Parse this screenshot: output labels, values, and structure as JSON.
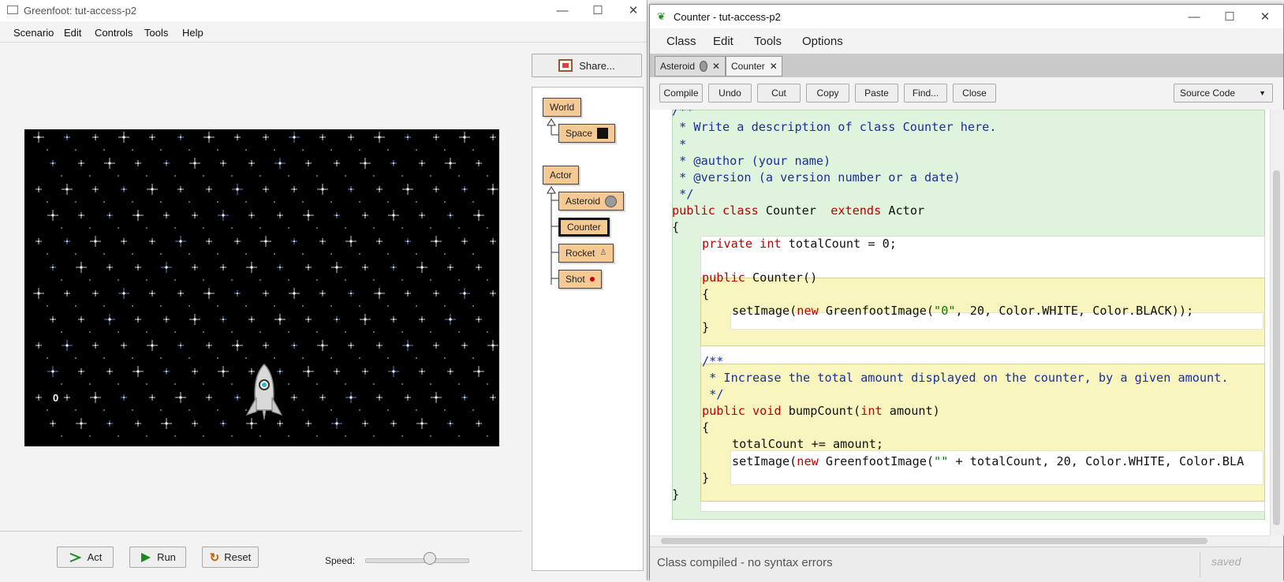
{
  "main_window": {
    "title": "Greenfoot: tut-access-p2",
    "controls": {
      "minimize": "—",
      "maximize": "☐",
      "close": "✕"
    },
    "menu": [
      "Scenario",
      "Edit",
      "Controls",
      "Tools",
      "Help"
    ],
    "counter_value": "0",
    "buttons": {
      "act": "Act",
      "run": "Run",
      "reset": "Reset",
      "share": "Share..."
    },
    "speed_label": "Speed:",
    "speed_level": 0.62,
    "classes": {
      "world": "World",
      "space": "Space",
      "actor": "Actor",
      "asteroid": "Asteroid",
      "counter": "Counter",
      "rocket": "Rocket",
      "shot": "Shot"
    }
  },
  "editor_window": {
    "title": "Counter - tut-access-p2",
    "controls": {
      "minimize": "—",
      "maximize": "☐",
      "close": "✕"
    },
    "menu": [
      "Class",
      "Edit",
      "Tools",
      "Options"
    ],
    "tabs": [
      {
        "label": "Asteroid",
        "close": "✕"
      },
      {
        "label": "Counter",
        "close": "✕"
      }
    ],
    "toolbar": [
      "Compile",
      "Undo",
      "Cut",
      "Copy",
      "Paste",
      "Find...",
      "Close"
    ],
    "view_select": "Source Code",
    "code": {
      "l0": "/**",
      "l1": " * Write a description of class Counter here.",
      "l2": " *",
      "l3": " * @author (your name)",
      "l4": " * @version (a version number or a date)",
      "l5": " */",
      "l6_kw1": "public",
      "l6_kw2": "class",
      "l6_name": "Counter",
      "l6_kw3": "extends",
      "l6_parent": "Actor",
      "l7": "{",
      "l8_kw1": "private",
      "l8_kw2": "int",
      "l8_rest": "totalCount = 0;",
      "l10_kw": "public",
      "l10_rest": "Counter()",
      "l11": "{",
      "l12_a": "setImage(",
      "l12_kw": "new",
      "l12_b": "GreenfootImage(",
      "l12_str": "\"0\"",
      "l12_c": ", 20, Color.WHITE, Color.BLACK));",
      "l13": "}",
      "l15": "/**",
      "l16": " * Increase the total amount displayed on the counter, by a given amount.",
      "l17": " */",
      "l18_kw1": "public",
      "l18_kw2": "void",
      "l18_a": "bumpCount(",
      "l18_kw3": "int",
      "l18_b": "amount)",
      "l19": "{",
      "l20": "totalCount += amount;",
      "l21_a": "setImage(",
      "l21_kw": "new",
      "l21_b": "GreenfootImage(",
      "l21_str": "\"\"",
      "l21_c": " + totalCount, 20, Color.WHITE, Color.BLA",
      "l22": "}",
      "l23": "}"
    },
    "status": "Class compiled - no syntax errors",
    "saved": "saved"
  }
}
